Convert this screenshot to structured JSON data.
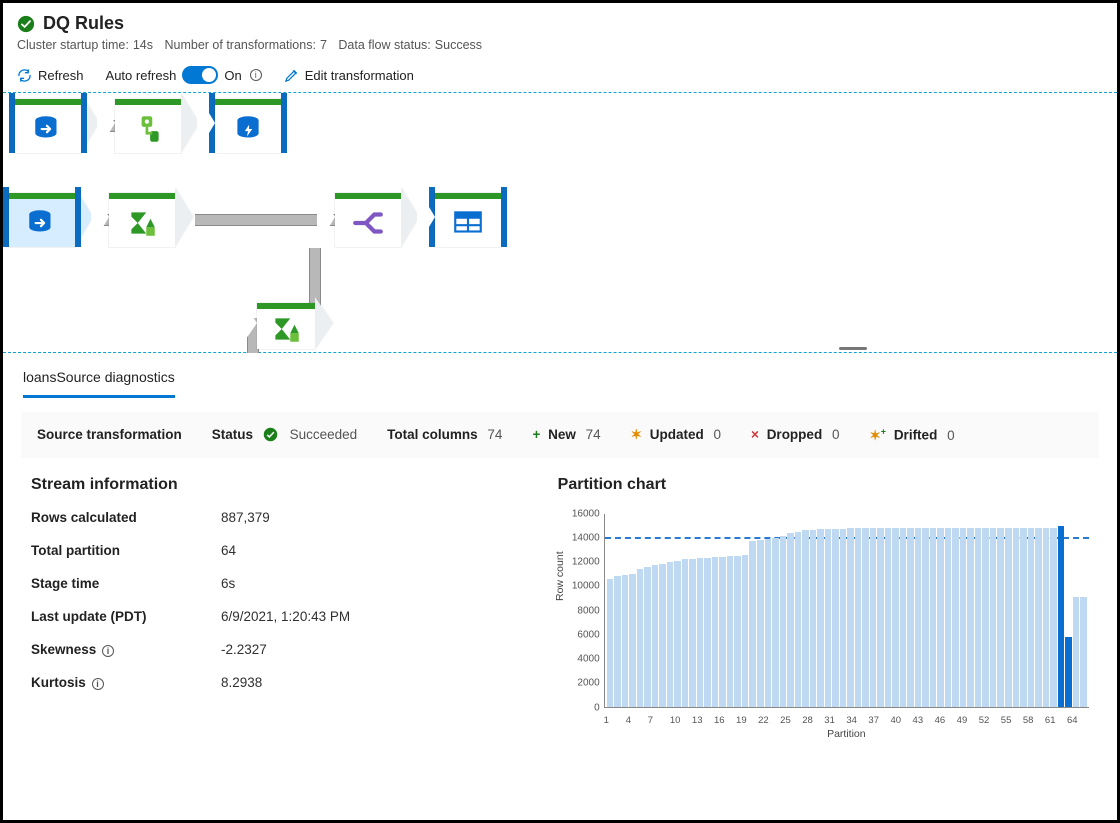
{
  "header": {
    "title": "DQ Rules",
    "status_icon": "success",
    "subtitle": {
      "cluster_label": "Cluster startup time:",
      "cluster_value": "14s",
      "transforms_label": "Number of transformations:",
      "transforms_value": "7",
      "flow_label": "Data flow status:",
      "flow_value": "Success"
    }
  },
  "toolbar": {
    "refresh": "Refresh",
    "auto_refresh": "Auto refresh",
    "on": "On",
    "edit": "Edit transformation"
  },
  "nodes": {
    "row1": [
      "source",
      "derive",
      "sink"
    ],
    "row2": [
      "source-sel",
      "aggregate",
      "split",
      "table"
    ],
    "branch": "aggregate"
  },
  "tab": "loansSource diagnostics",
  "stats": {
    "src_transform": "Source transformation",
    "status_label": "Status",
    "status_value": "Succeeded",
    "total_cols_label": "Total columns",
    "total_cols_value": "74",
    "new_label": "New",
    "new_value": "74",
    "updated_label": "Updated",
    "updated_value": "0",
    "dropped_label": "Dropped",
    "dropped_value": "0",
    "drifted_label": "Drifted",
    "drifted_value": "0"
  },
  "stream": {
    "heading": "Stream information",
    "rows_calculated_k": "Rows calculated",
    "rows_calculated_v": "887,379",
    "total_partition_k": "Total partition",
    "total_partition_v": "64",
    "stage_time_k": "Stage time",
    "stage_time_v": "6s",
    "last_update_k": "Last update (PDT)",
    "last_update_v": "6/9/2021, 1:20:43 PM",
    "skewness_k": "Skewness",
    "skewness_v": "-2.2327",
    "kurtosis_k": "Kurtosis",
    "kurtosis_v": "8.2938"
  },
  "chart_data": {
    "type": "bar",
    "title": "Partition chart",
    "xlabel": "Partition",
    "ylabel": "Row count",
    "ylim": [
      0,
      16000
    ],
    "y_ticks": [
      0,
      2000,
      4000,
      6000,
      8000,
      10000,
      12000,
      14000,
      16000
    ],
    "x_tick_labels": [
      1,
      4,
      7,
      10,
      13,
      16,
      19,
      22,
      25,
      28,
      31,
      34,
      37,
      40,
      43,
      46,
      49,
      52,
      55,
      58,
      61,
      64
    ],
    "average": 13870,
    "highlight": [
      61,
      62
    ],
    "values": [
      10600,
      10800,
      10900,
      11000,
      11400,
      11600,
      11700,
      11800,
      12000,
      12100,
      12200,
      12200,
      12300,
      12300,
      12400,
      12400,
      12500,
      12500,
      12600,
      13700,
      13800,
      13900,
      14000,
      14100,
      14400,
      14500,
      14600,
      14600,
      14700,
      14700,
      14700,
      14700,
      14800,
      14800,
      14800,
      14800,
      14800,
      14800,
      14800,
      14800,
      14800,
      14800,
      14800,
      14800,
      14800,
      14800,
      14800,
      14800,
      14800,
      14800,
      14800,
      14800,
      14800,
      14800,
      14800,
      14800,
      14800,
      14800,
      14800,
      14800,
      15000,
      5800,
      9100,
      9100
    ]
  }
}
